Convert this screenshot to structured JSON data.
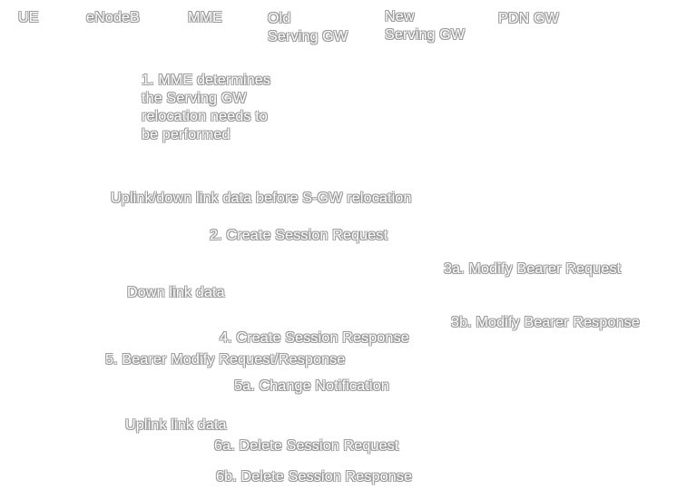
{
  "entities": {
    "ue": "UE",
    "enodeb": "eNodeB",
    "mme": "MME",
    "old_sgw": "Old\nServing GW",
    "new_sgw": "New\nServing GW",
    "pdn_gw": "PDN GW"
  },
  "steps": {
    "step1": "1. MME determines\nthe Serving GW\nrelocation needs to\nbe performed",
    "uplink_downlink_before": "Uplink/down link data before S-GW relocation",
    "step2": "2. Create Session Request",
    "step3a": "3a. Modify Bearer Request",
    "downlink_data": "Down link data",
    "step3b": "3b. Modify Bearer Response",
    "step4": "4. Create Session Response",
    "step5": "5. Bearer Modify Request/Response",
    "step5a": "5a. Change Notification",
    "uplink_data": "Uplink link data",
    "step6a": "6a. Delete Session Request",
    "step6b": "6b. Delete Session Response"
  }
}
